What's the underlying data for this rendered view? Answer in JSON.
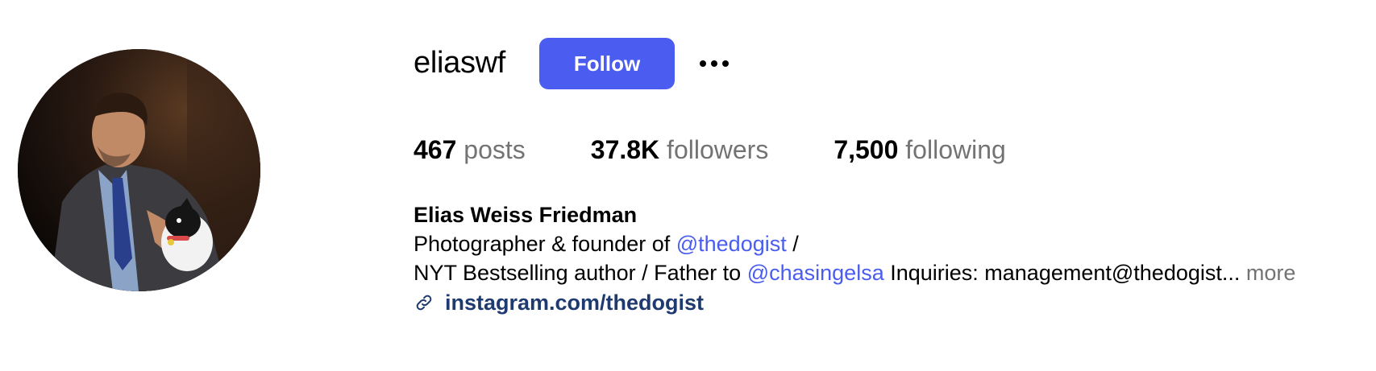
{
  "profile": {
    "username": "eliaswf",
    "follow_label": "Follow",
    "more_options_icon": "ellipsis-icon",
    "avatar_icon": "profile-photo"
  },
  "stats": {
    "posts_count": "467",
    "posts_label": "posts",
    "followers_count": "37.8K",
    "followers_label": "followers",
    "following_count": "7,500",
    "following_label": "following"
  },
  "bio": {
    "full_name": "Elias Weiss Friedman",
    "line1_text": "Photographer & founder of ",
    "line1_mention": "@thedogist",
    "line1_suffix": " /",
    "line2_text": "NYT Bestselling author / Father to ",
    "line2_mention": "@chasingelsa",
    "line2_suffix": " Inquiries: management@thedogist...",
    "more_label": "more",
    "link_icon": "link-icon",
    "link_text": "instagram.com/thedogist"
  },
  "colors": {
    "accent": "#4a5df0",
    "secondary_text": "#737373",
    "link": "#1e3a6e"
  }
}
